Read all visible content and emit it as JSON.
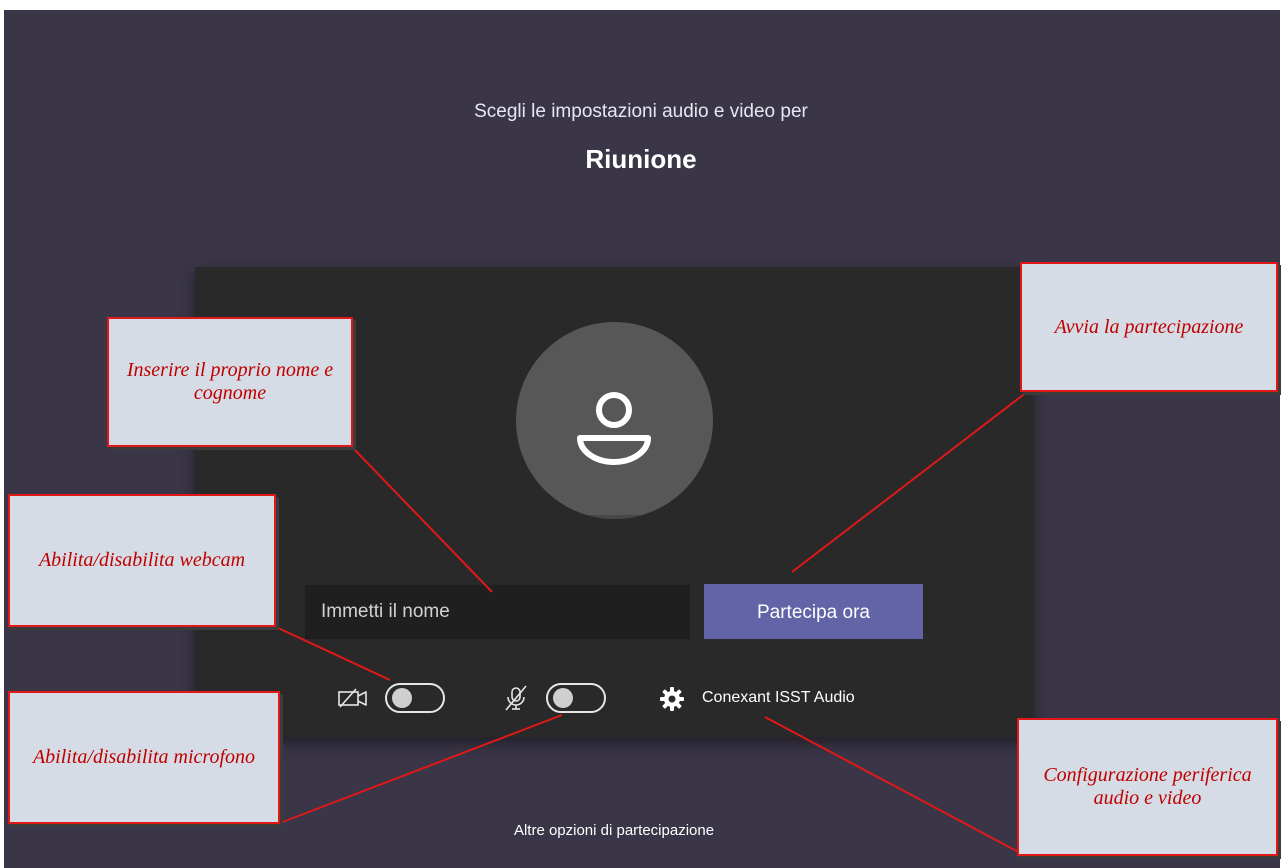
{
  "header": {
    "subtitle": "Scegli le impostazioni audio e video per",
    "meeting_title": "Riunione"
  },
  "form": {
    "name_placeholder": "Immetti il nome",
    "join_label": "Partecipa ora"
  },
  "controls": {
    "camera_toggle_state": "off",
    "microphone_toggle_state": "off",
    "device_label": "Conexant ISST Audio"
  },
  "footer": {
    "other_options": "Altre opzioni di partecipazione"
  },
  "annotations": {
    "name_hint": "Inserire il proprio nome e cognome",
    "join_hint": "Avvia la partecipazione",
    "webcam_hint": "Abilita/disabilita webcam",
    "mic_hint": "Abilita/disabilita microfono",
    "device_hint": "Configurazione periferica audio e video"
  },
  "colors": {
    "background": "#3a3647",
    "panel": "#292929",
    "accent": "#6264a7",
    "callout_fill": "#d6dce5",
    "callout_text": "#c00000",
    "callout_border": "#e01818"
  }
}
